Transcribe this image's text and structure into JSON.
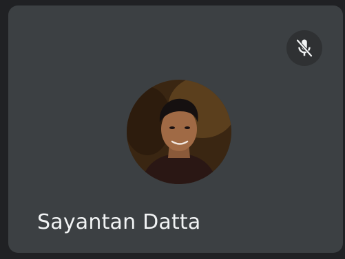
{
  "participant": {
    "name": "Sayantan Datta",
    "mic_state": "muted",
    "mic_icon": "mic-off-icon",
    "avatar_icon": "participant-photo"
  },
  "colors": {
    "tile_background": "#3c4043",
    "page_background": "#202124",
    "badge_background": "#2f3133",
    "text": "#f1f3f4"
  }
}
